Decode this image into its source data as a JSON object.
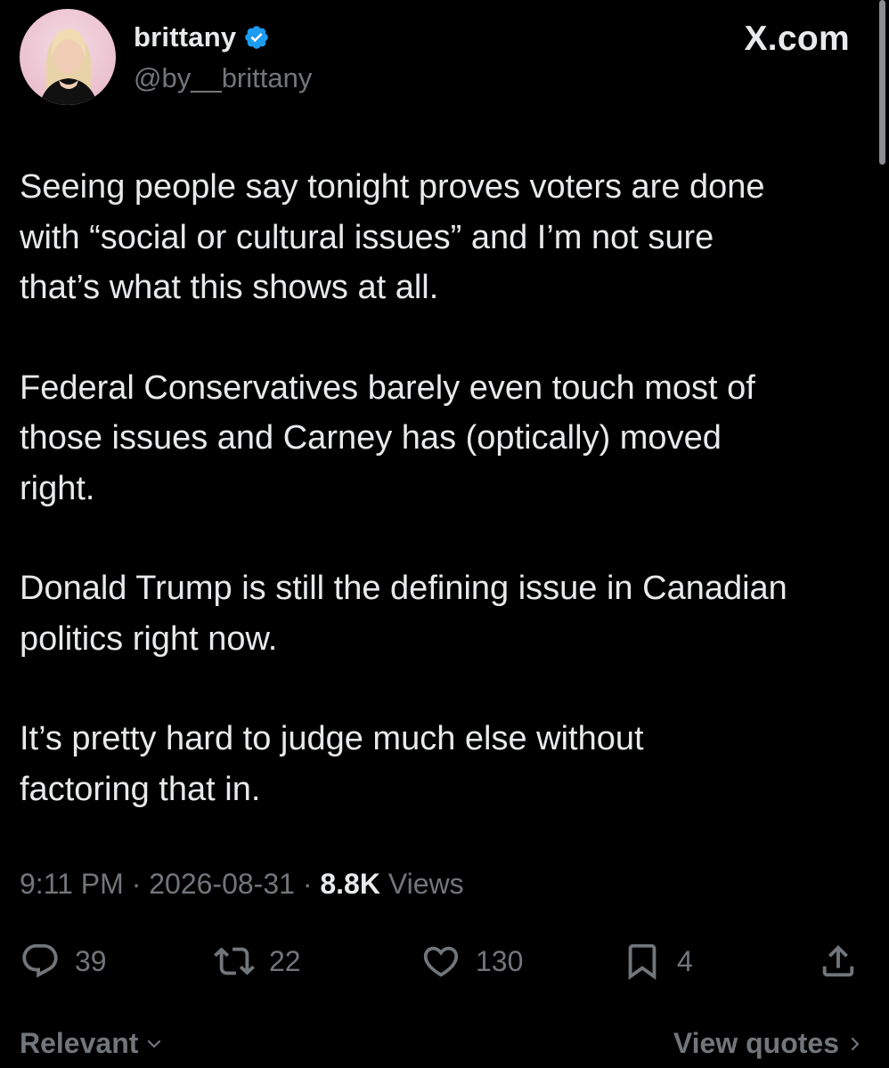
{
  "author": {
    "display_name": "brittany",
    "handle": "@by__brittany",
    "verified": true,
    "avatar_icon": "profile-photo"
  },
  "source_label": "X.com",
  "tweet": {
    "paragraphs": [
      "Seeing people say tonight proves voters are done\nwith “social or cultural issues” and I’m not sure\nthat’s what this shows at all.",
      "Federal Conservatives barely even touch most of\nthose issues and Carney has (optically) moved\nright.",
      "Donald Trump is still the defining issue in Canadian\npolitics right now.",
      "It’s pretty hard to judge much else without\nfactoring that in."
    ]
  },
  "meta": {
    "time": "9:11 PM",
    "separator": " · ",
    "date": "2026-08-31",
    "views_count": "8.8K",
    "views_label": " Views"
  },
  "actions": {
    "replies": "39",
    "reposts": "22",
    "likes": "130",
    "bookmarks": "4"
  },
  "footer": {
    "sort_label": "Relevant",
    "quotes_label": "View quotes"
  },
  "colors": {
    "background": "#000000",
    "text": "#e7e9ea",
    "secondary": "#71767b",
    "verified_badge": "#1d9bf0"
  }
}
